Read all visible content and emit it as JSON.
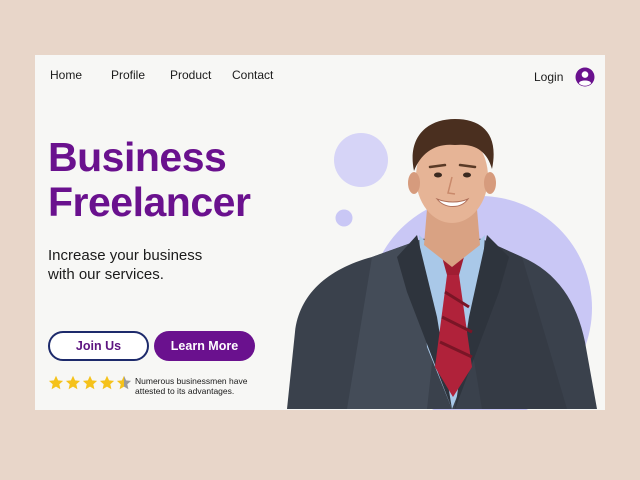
{
  "nav": {
    "items": [
      {
        "label": "Home"
      },
      {
        "label": "Profile"
      },
      {
        "label": "Product"
      },
      {
        "label": "Contact"
      }
    ],
    "login_label": "Login",
    "user_icon": "user-circle-icon"
  },
  "hero": {
    "title_line1": "Business",
    "title_line2": "Freelancer",
    "subtitle_line1": "Increase your business",
    "subtitle_line2": "with our services.",
    "primary_button": "Join Us",
    "secondary_button": "Learn More",
    "rating": 4.5,
    "rating_text_line1": "Numerous businessmen have",
    "rating_text_line2": "attested to its advantages."
  },
  "colors": {
    "accent": "#6a118e",
    "outline": "#1d2a6b",
    "deco_circle": "#c9c7f5",
    "star": "#f5c21b",
    "background": "#e8d6c9",
    "card": "#f7f7f5"
  }
}
